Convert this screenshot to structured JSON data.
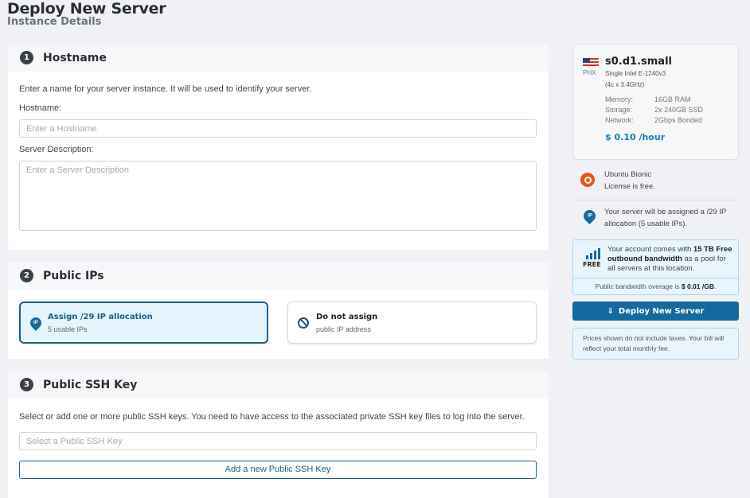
{
  "header": {
    "title": "Deploy New Server",
    "subtitle": "Instance Details"
  },
  "hostname": {
    "num": "1",
    "title": "Hostname",
    "desc": "Enter a name for your server instance. It will be used to identify your server.",
    "hostname_label": "Hostname:",
    "hostname_placeholder": "Enter a Hostname",
    "description_label": "Server Description:",
    "description_placeholder": "Enter a Server Description"
  },
  "ips": {
    "num": "2",
    "title": "Public IPs",
    "options": [
      {
        "title": "Assign /29 IP allocation",
        "sub": "5 usable IPs",
        "icon": "IP",
        "selected": true
      },
      {
        "title": "Do not assign",
        "sub": "public IP address",
        "selected": false
      }
    ]
  },
  "ssh": {
    "num": "3",
    "title": "Public SSH Key",
    "desc": "Select or add one or more public SSH keys. You need to have access to the associated private SSH key files to log into the server.",
    "placeholder": "Select a Public SSH Key",
    "add_label": "Add a new Public SSH Key"
  },
  "summary": {
    "location": "PHX",
    "plan": "s0.d1.small",
    "cpu": "Single Intel E-1240v3",
    "cpu_detail": "(4c x 3.4GHz)",
    "specs": [
      {
        "k": "Memory:",
        "v": "16GB RAM"
      },
      {
        "k": "Storage:",
        "v": "2x 240GB SSD"
      },
      {
        "k": "Network:",
        "v": "2Gbps Bonded"
      }
    ],
    "price": "$ 0.10 /hour",
    "os_name": "Ubuntu Bionic",
    "os_license": "License is free.",
    "ip_icon": "IP",
    "ip_text": "Your server will be assigned a /29 IP allocation (5 usable IPs).",
    "bw_pre": "Your account comes with ",
    "bw_bold": "15 TB Free outbound bandwidth",
    "bw_post": " as a pool for all servers at this location.",
    "free_label": "FREE",
    "overage_pre": "Public bandwidth overage is ",
    "overage_val": "$ 0.01 /GB",
    "overage_post": ".",
    "deploy_label": "Deploy New Server",
    "note": "Prices shown do not include taxes. Your bill will reflect your total monthly fee."
  },
  "colors": {
    "accent": "#1a6a9e",
    "ubuntu": "#e95420"
  }
}
